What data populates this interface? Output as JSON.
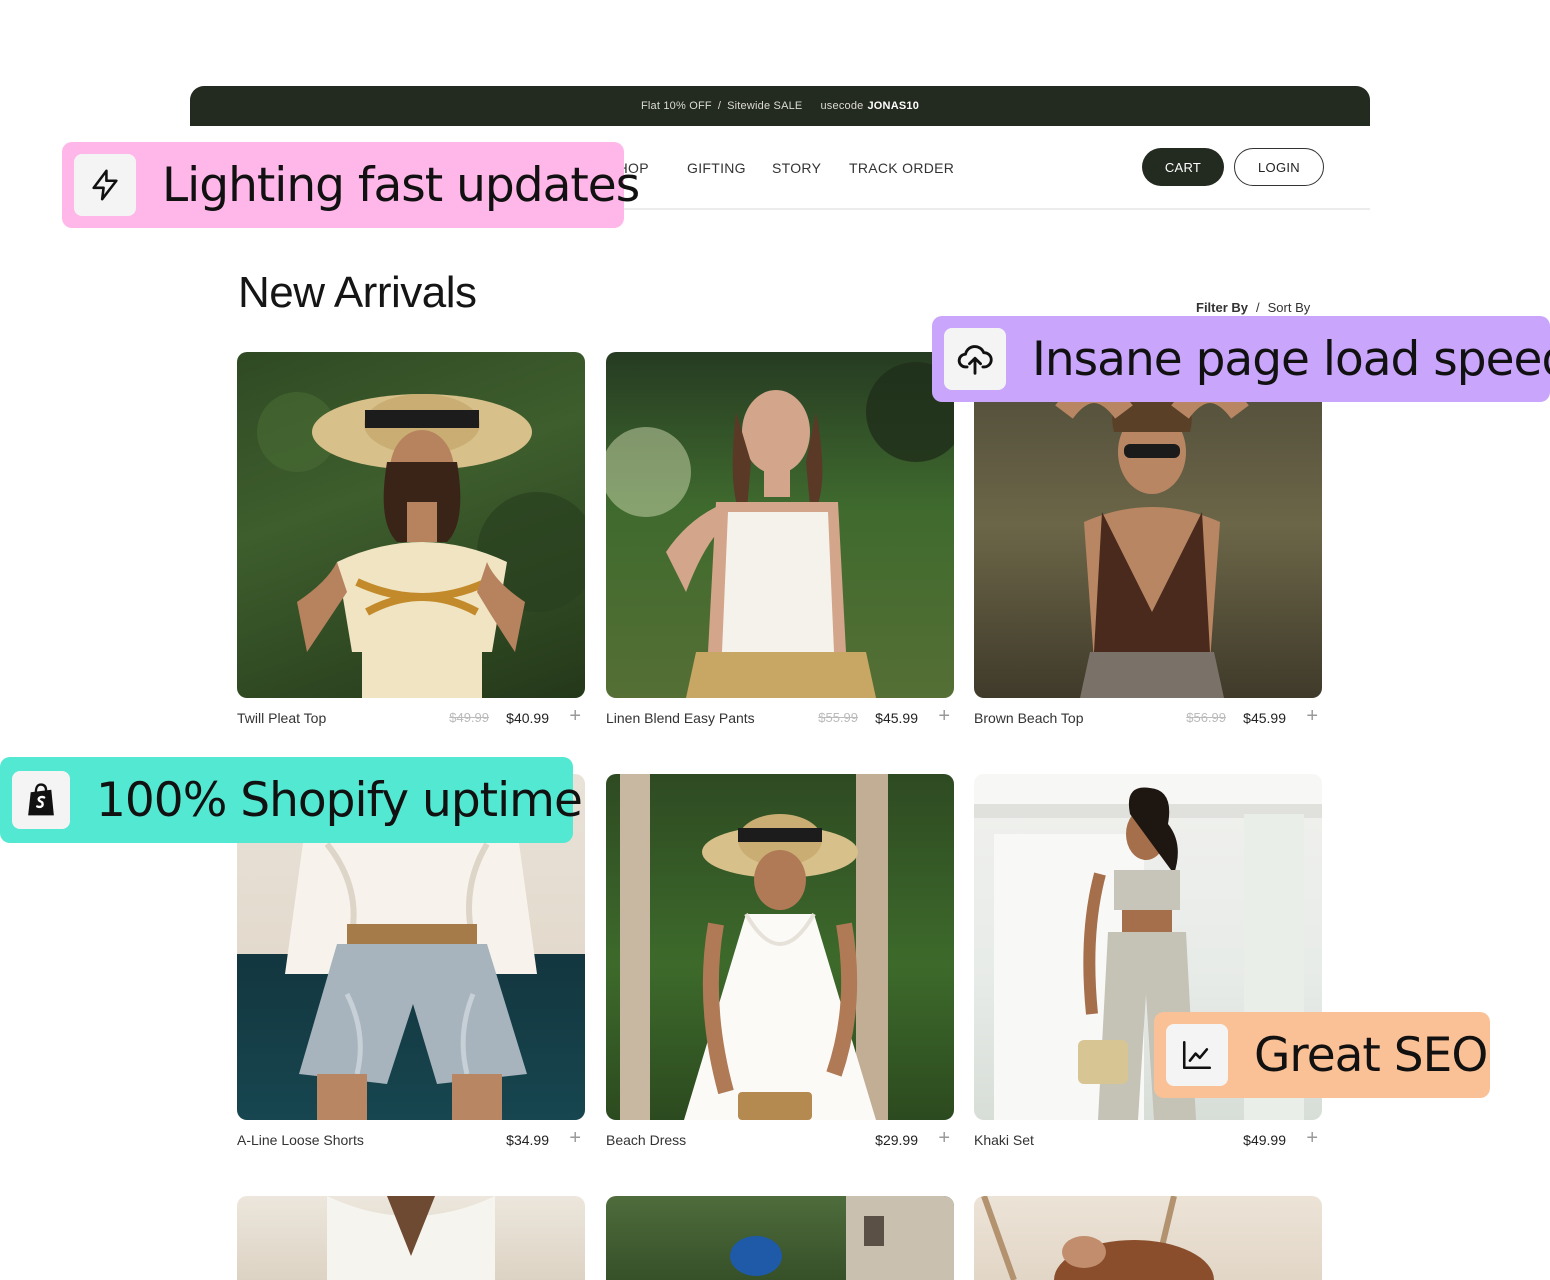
{
  "announcement": {
    "offer": "Flat 10% OFF",
    "separator": "/",
    "sale": "Sitewide SALE",
    "code_prefix": "usecode",
    "code": "JONAS10"
  },
  "nav": {
    "links": [
      "SHOP",
      "GIFTING",
      "STORY",
      "TRACK ORDER"
    ],
    "cart": "CART",
    "login": "LOGIN"
  },
  "page": {
    "title": "New Arrivals",
    "filter": "Filter By",
    "divider": "/",
    "sort": "Sort By"
  },
  "products": [
    {
      "name": "Twill Pleat Top",
      "old_price": "$49.99",
      "price": "$40.99"
    },
    {
      "name": "Linen Blend Easy Pants",
      "old_price": "$55.99",
      "price": "$45.99"
    },
    {
      "name": "Brown Beach Top",
      "old_price": "$56.99",
      "price": "$45.99"
    },
    {
      "name": "A-Line Loose Shorts",
      "old_price": "",
      "price": "$34.99"
    },
    {
      "name": "Beach Dress",
      "old_price": "",
      "price": "$29.99"
    },
    {
      "name": "Khaki Set",
      "old_price": "",
      "price": "$49.99"
    }
  ],
  "add_symbol": "+",
  "badges": [
    {
      "text": "Lighting fast updates",
      "icon": "lightning-icon",
      "color": "#ffb6e9"
    },
    {
      "text": "Insane page load speed",
      "icon": "cloud-upload-icon",
      "color": "#c9a5fb"
    },
    {
      "text": "100% Shopify uptime",
      "icon": "shopify-bag-icon",
      "color": "#53e8d2"
    },
    {
      "text": "Great SEO",
      "icon": "line-chart-icon",
      "color": "#fbc196"
    }
  ],
  "colors": {
    "dark_green": "#232a1f",
    "pink": "#ffb6e9",
    "purple": "#c9a5fb",
    "teal": "#53e8d2",
    "peach": "#fbc196"
  }
}
